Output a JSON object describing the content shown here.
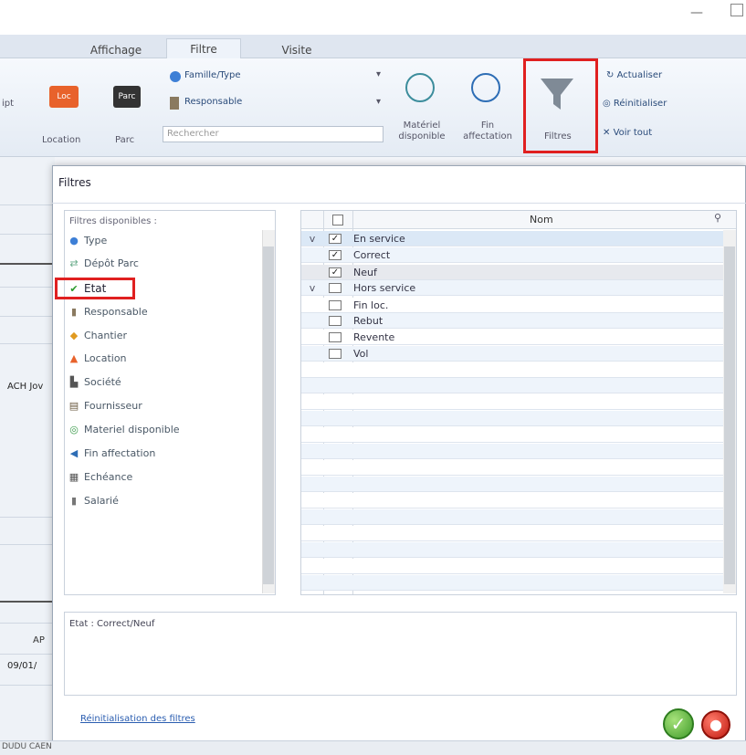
{
  "window": {
    "minimize_glyph": "—"
  },
  "tabs": [
    {
      "label": "Affichage"
    },
    {
      "label": "Filtre"
    },
    {
      "label": "Visite"
    }
  ],
  "ribbon": {
    "left_cut_label": "ipt",
    "location_label": "Location",
    "parc_label": "Parc",
    "famille_type_label": "Famille/Type",
    "responsable_label": "Responsable",
    "search_placeholder": "Rechercher",
    "materiel_label_1": "Matériel",
    "materiel_label_2": "disponible",
    "fin_label_1": "Fin",
    "fin_label_2": "affectation",
    "filtres_label": "Filtres",
    "actualiser_label": "Actualiser",
    "reinitialiser_label": "Réinitialiser",
    "voir_tout_label": "Voir tout",
    "loc_badge": "Loc",
    "parc_badge": "Parc"
  },
  "background": {
    "ach_text": "ACH Jov",
    "date_text": "09/01/",
    "bottom_text": "DUDU CAEN",
    "ab_text": "AP"
  },
  "dialog": {
    "title": "Filtres",
    "available_label": "Filtres disponibles :",
    "filters": [
      {
        "label": "Type",
        "icon": "type-icon"
      },
      {
        "label": "Dépôt Parc",
        "icon": "depot-icon"
      },
      {
        "label": "Etat",
        "icon": "check-icon"
      },
      {
        "label": "Responsable",
        "icon": "person-icon"
      },
      {
        "label": "Chantier",
        "icon": "chantier-icon"
      },
      {
        "label": "Location",
        "icon": "location-icon"
      },
      {
        "label": "Société",
        "icon": "societe-icon"
      },
      {
        "label": "Fournisseur",
        "icon": "fournisseur-icon"
      },
      {
        "label": "Materiel disponible",
        "icon": "check-circle-icon"
      },
      {
        "label": "Fin affectation",
        "icon": "arrow-circle-icon"
      },
      {
        "label": "Echéance",
        "icon": "calendar-icon"
      },
      {
        "label": "Salarié",
        "icon": "salarie-icon"
      }
    ],
    "grid": {
      "header_name": "Nom",
      "rows": [
        {
          "expand": "v",
          "checked": true,
          "name": "En service"
        },
        {
          "expand": "",
          "checked": true,
          "name": "Correct"
        },
        {
          "expand": "",
          "checked": true,
          "name": "Neuf"
        },
        {
          "expand": "v",
          "checked": false,
          "name": "Hors service"
        },
        {
          "expand": "",
          "checked": false,
          "name": "Fin loc."
        },
        {
          "expand": "",
          "checked": false,
          "name": "Rebut"
        },
        {
          "expand": "",
          "checked": false,
          "name": "Revente"
        },
        {
          "expand": "",
          "checked": false,
          "name": "Vol"
        }
      ]
    },
    "summary": "Etat : Correct/Neuf",
    "reset_link": "Réinitialisation des filtres",
    "ok_glyph": "✓",
    "cancel_glyph": "●"
  },
  "colors": {
    "highlight": "#e02020",
    "accent": "#3c8d9c"
  }
}
